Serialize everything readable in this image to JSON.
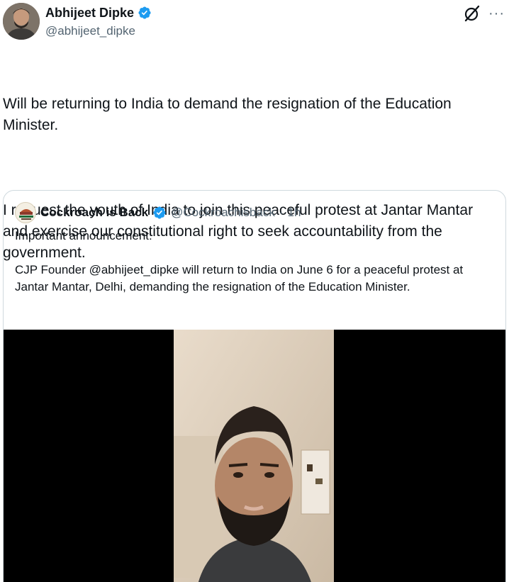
{
  "tweet": {
    "author": {
      "name": "Abhijeet Dipke",
      "handle": "@abhijeet_dipke",
      "verified_icon": "verified-badge-icon",
      "avatar_icon": "avatar"
    },
    "actions": {
      "grok_icon": "grok-icon",
      "more_label": "···"
    },
    "paragraphs": [
      "Will be returning to India to demand the resignation of the Education Minister.",
      "I request the youth of India to join this peaceful protest at Jantar Mantar and exercise our constitutional right to seek accountability from the government."
    ]
  },
  "quote": {
    "name": "Cockroach is Back",
    "handle": "@Cockroachisback",
    "separator": "·",
    "time": "1h",
    "paragraphs": [
      "Important announcement:",
      "CJP Founder @abhijeet_dipke will return to India on June 6 for a peaceful protest at Jantar Mantar, Delhi, demanding the resignation of the Education Minister."
    ],
    "media": {
      "type": "video",
      "background": "#000000"
    }
  },
  "colors": {
    "text": "#0f1419",
    "secondary": "#536471",
    "verified_blue": "#1d9bf0",
    "border": "#cfd9de"
  }
}
